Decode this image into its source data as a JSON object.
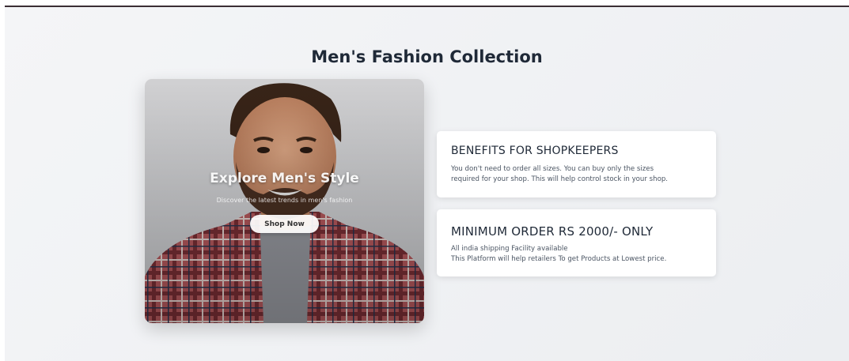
{
  "page": {
    "title": "Men's Fashion Collection"
  },
  "hero": {
    "heading": "Explore Men's Style",
    "subheading": "Discover the latest trends in men's fashion",
    "button_label": "Shop Now",
    "image": "man-in-plaid-shirt-photo"
  },
  "cards": [
    {
      "title": "BENEFITS FOR SHOPKEEPERS",
      "lines": [
        "You don't need to order all sizes. You can buy only the sizes",
        "required for your shop. This will help control stock in your shop."
      ]
    },
    {
      "title": "MINIMUM ORDER RS 2000/- ONLY",
      "lines": [
        "All india shipping Facility available",
        "This Platform will help retailers To get Products at Lowest price."
      ]
    }
  ],
  "colors": {
    "heading": "#1f2937",
    "background": "#eef0f2",
    "card": "#ffffff"
  }
}
